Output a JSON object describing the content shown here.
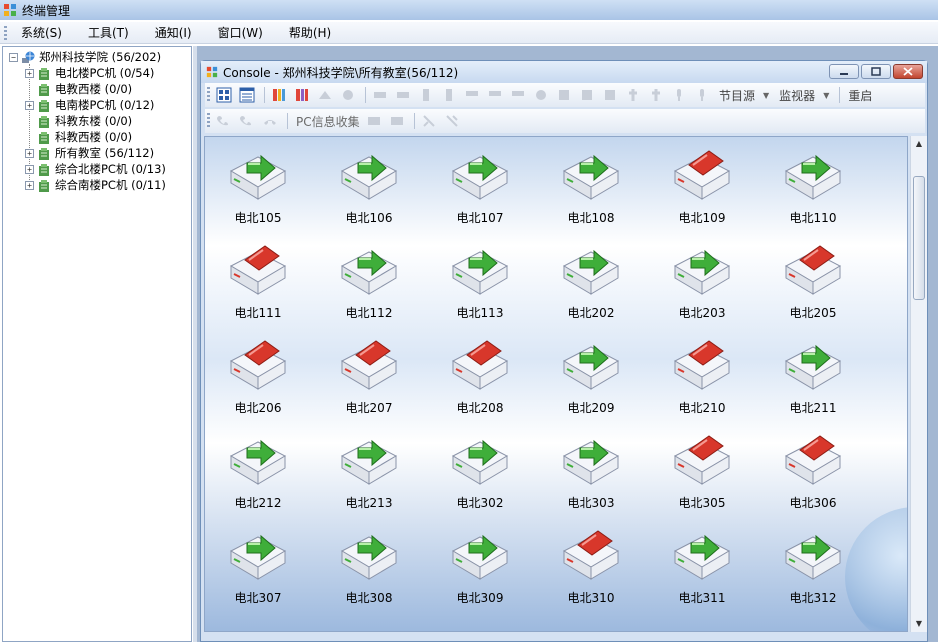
{
  "window": {
    "title": "终端管理"
  },
  "menu": [
    {
      "label": "系统(S)"
    },
    {
      "label": "工具(T)"
    },
    {
      "label": "通知(I)"
    },
    {
      "label": "窗口(W)"
    },
    {
      "label": "帮助(H)"
    }
  ],
  "tree": {
    "root": {
      "label": "郑州科技学院 (56/202)"
    },
    "children": [
      {
        "label": "电北楼PC机 (0/54)"
      },
      {
        "label": "电教西楼 (0/0)"
      },
      {
        "label": "电南楼PC机 (0/12)"
      },
      {
        "label": "科教东楼 (0/0)"
      },
      {
        "label": "科教西楼 (0/0)"
      },
      {
        "label": "所有教室 (56/112)"
      },
      {
        "label": "综合北楼PC机 (0/13)"
      },
      {
        "label": "综合南楼PC机 (0/11)"
      }
    ]
  },
  "console": {
    "title": "Console - 郑州科技学院\\所有教室(56/112)",
    "toolbar": {
      "source_label": "节目源",
      "monitor_label": "监视器",
      "restart_label": "重启",
      "pcinfo_label": "PC信息收集"
    }
  },
  "colors": {
    "online": "#3fae3a",
    "offline": "#d8372b"
  },
  "terminals": [
    {
      "name": "电北105",
      "status": "online"
    },
    {
      "name": "电北106",
      "status": "online"
    },
    {
      "name": "电北107",
      "status": "online"
    },
    {
      "name": "电北108",
      "status": "online"
    },
    {
      "name": "电北109",
      "status": "offline"
    },
    {
      "name": "电北110",
      "status": "online"
    },
    {
      "name": "电北111",
      "status": "offline"
    },
    {
      "name": "电北112",
      "status": "online"
    },
    {
      "name": "电北113",
      "status": "online"
    },
    {
      "name": "电北202",
      "status": "online"
    },
    {
      "name": "电北203",
      "status": "online"
    },
    {
      "name": "电北205",
      "status": "offline"
    },
    {
      "name": "电北206",
      "status": "offline"
    },
    {
      "name": "电北207",
      "status": "offline"
    },
    {
      "name": "电北208",
      "status": "offline"
    },
    {
      "name": "电北209",
      "status": "online"
    },
    {
      "name": "电北210",
      "status": "offline"
    },
    {
      "name": "电北211",
      "status": "online"
    },
    {
      "name": "电北212",
      "status": "online"
    },
    {
      "name": "电北213",
      "status": "online"
    },
    {
      "name": "电北302",
      "status": "online"
    },
    {
      "name": "电北303",
      "status": "online"
    },
    {
      "name": "电北305",
      "status": "offline"
    },
    {
      "name": "电北306",
      "status": "offline"
    },
    {
      "name": "电北307",
      "status": "online"
    },
    {
      "name": "电北308",
      "status": "online"
    },
    {
      "name": "电北309",
      "status": "online"
    },
    {
      "name": "电北310",
      "status": "offline"
    },
    {
      "name": "电北311",
      "status": "online"
    },
    {
      "name": "电北312",
      "status": "online"
    }
  ]
}
